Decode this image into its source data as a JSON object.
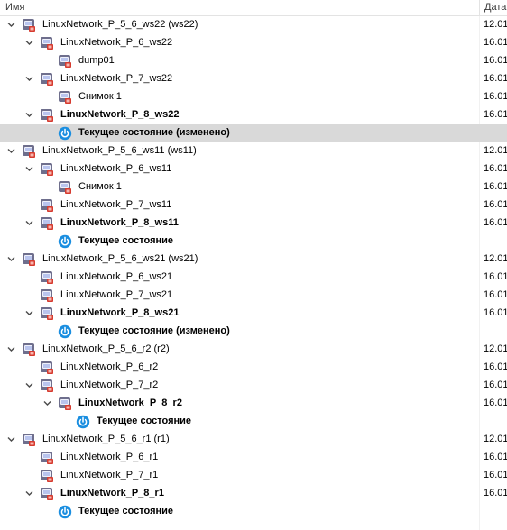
{
  "header": {
    "col_name": "Имя",
    "col_date": "Дата"
  },
  "rows": [
    {
      "label": "LinuxNetwork_P_5_6_ws22 (ws22)",
      "date": "12.01",
      "level": 0,
      "chev": true,
      "icon": "vm-icon",
      "bold": false,
      "sel": false
    },
    {
      "label": "LinuxNetwork_P_6_ws22",
      "date": "16.01",
      "level": 1,
      "chev": true,
      "icon": "vm-icon",
      "bold": false,
      "sel": false
    },
    {
      "label": "dump01",
      "date": "16.01",
      "level": 2,
      "chev": false,
      "icon": "vm-icon",
      "bold": false,
      "sel": false
    },
    {
      "label": "LinuxNetwork_P_7_ws22",
      "date": "16.01",
      "level": 1,
      "chev": true,
      "icon": "vm-icon",
      "bold": false,
      "sel": false
    },
    {
      "label": "Снимок 1",
      "date": "16.01",
      "level": 2,
      "chev": false,
      "icon": "vm-icon",
      "bold": false,
      "sel": false
    },
    {
      "label": "LinuxNetwork_P_8_ws22",
      "date": "16.01",
      "level": 1,
      "chev": true,
      "icon": "vm-icon",
      "bold": true,
      "sel": false
    },
    {
      "label": "Текущее состояние (изменено)",
      "date": "",
      "level": 2,
      "chev": false,
      "icon": "power-icon",
      "bold": true,
      "sel": true
    },
    {
      "label": "LinuxNetwork_P_5_6_ws11 (ws11)",
      "date": "12.01",
      "level": 0,
      "chev": true,
      "icon": "vm-icon",
      "bold": false,
      "sel": false
    },
    {
      "label": "LinuxNetwork_P_6_ws11",
      "date": "16.01",
      "level": 1,
      "chev": true,
      "icon": "vm-icon",
      "bold": false,
      "sel": false
    },
    {
      "label": "Снимок 1",
      "date": "16.01",
      "level": 2,
      "chev": false,
      "icon": "vm-icon",
      "bold": false,
      "sel": false
    },
    {
      "label": "LinuxNetwork_P_7_ws11",
      "date": "16.01",
      "level": 1,
      "chev": false,
      "icon": "vm-icon",
      "bold": false,
      "sel": false
    },
    {
      "label": "LinuxNetwork_P_8_ws11",
      "date": "16.01",
      "level": 1,
      "chev": true,
      "icon": "vm-icon",
      "bold": true,
      "sel": false
    },
    {
      "label": "Текущее состояние",
      "date": "",
      "level": 2,
      "chev": false,
      "icon": "power-icon",
      "bold": true,
      "sel": false
    },
    {
      "label": "LinuxNetwork_P_5_6_ws21 (ws21)",
      "date": "12.01",
      "level": 0,
      "chev": true,
      "icon": "vm-icon",
      "bold": false,
      "sel": false
    },
    {
      "label": "LinuxNetwork_P_6_ws21",
      "date": "16.01",
      "level": 1,
      "chev": false,
      "icon": "vm-icon",
      "bold": false,
      "sel": false
    },
    {
      "label": "LinuxNetwork_P_7_ws21",
      "date": "16.01",
      "level": 1,
      "chev": false,
      "icon": "vm-icon",
      "bold": false,
      "sel": false
    },
    {
      "label": "LinuxNetwork_P_8_ws21",
      "date": "16.01",
      "level": 1,
      "chev": true,
      "icon": "vm-icon",
      "bold": true,
      "sel": false
    },
    {
      "label": "Текущее состояние (изменено)",
      "date": "",
      "level": 2,
      "chev": false,
      "icon": "power-icon",
      "bold": true,
      "sel": false
    },
    {
      "label": "LinuxNetwork_P_5_6_r2 (r2)",
      "date": "12.01",
      "level": 0,
      "chev": true,
      "icon": "vm-icon",
      "bold": false,
      "sel": false
    },
    {
      "label": "LinuxNetwork_P_6_r2",
      "date": "16.01",
      "level": 1,
      "chev": false,
      "icon": "vm-icon",
      "bold": false,
      "sel": false
    },
    {
      "label": "LinuxNetwork_P_7_r2",
      "date": "16.01",
      "level": 1,
      "chev": true,
      "icon": "vm-icon",
      "bold": false,
      "sel": false
    },
    {
      "label": "LinuxNetwork_P_8_r2",
      "date": "16.01",
      "level": 2,
      "chev": true,
      "icon": "vm-icon",
      "bold": true,
      "sel": false
    },
    {
      "label": "Текущее состояние",
      "date": "",
      "level": 3,
      "chev": false,
      "icon": "power-icon",
      "bold": true,
      "sel": false
    },
    {
      "label": "LinuxNetwork_P_5_6_r1 (r1)",
      "date": "12.01",
      "level": 0,
      "chev": true,
      "icon": "vm-icon",
      "bold": false,
      "sel": false
    },
    {
      "label": "LinuxNetwork_P_6_r1",
      "date": "16.01",
      "level": 1,
      "chev": false,
      "icon": "vm-icon",
      "bold": false,
      "sel": false
    },
    {
      "label": "LinuxNetwork_P_7_r1",
      "date": "16.01",
      "level": 1,
      "chev": false,
      "icon": "vm-icon",
      "bold": false,
      "sel": false
    },
    {
      "label": "LinuxNetwork_P_8_r1",
      "date": "16.01",
      "level": 1,
      "chev": true,
      "icon": "vm-icon",
      "bold": true,
      "sel": false
    },
    {
      "label": "Текущее состояние",
      "date": "",
      "level": 2,
      "chev": false,
      "icon": "power-icon",
      "bold": true,
      "sel": false
    }
  ],
  "colors": {
    "selected_row": "#d9d9d9",
    "power_icon": "#1a8ee0",
    "vm_icon_frame": "#6e6e8c",
    "vm_icon_badge": "#d63b2f"
  }
}
